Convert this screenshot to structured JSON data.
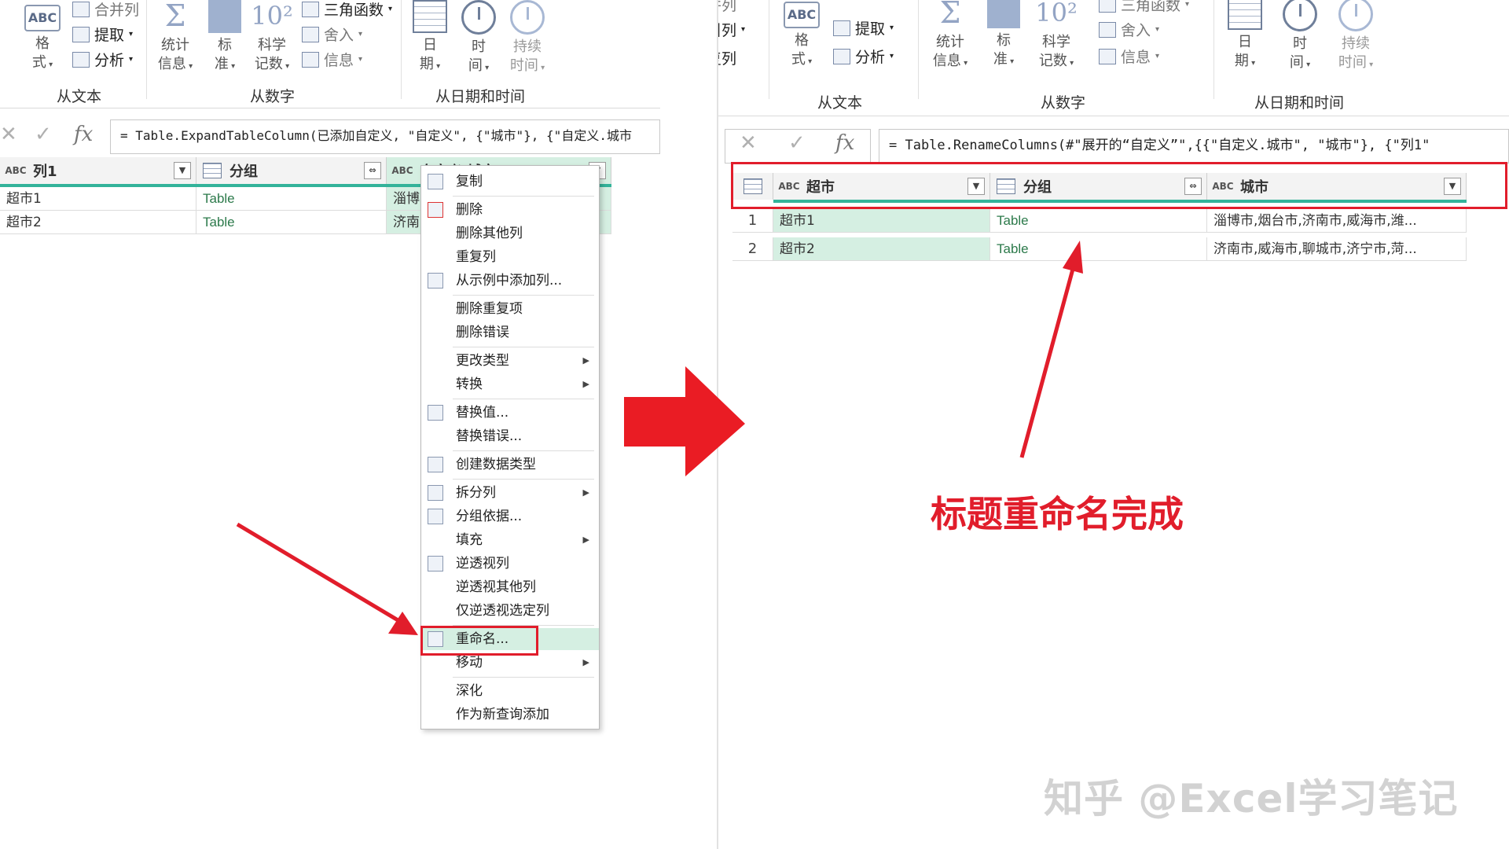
{
  "left": {
    "ribbon": {
      "items": {
        "format_line1": "格",
        "format_line2": "式",
        "merge": "合并列",
        "extract": "提取",
        "parse": "分析",
        "stats_line1": "统计",
        "stats_line2": "信息",
        "standard_line1": "标",
        "standard_line2": "准",
        "sci_line1": "科学",
        "sci_line2": "记数",
        "trig": "三角函数",
        "round": "舍入",
        "info": "信息",
        "date_line1": "日",
        "date_line2": "期",
        "time_line1": "时",
        "time_line2": "间",
        "duration_line1": "持续",
        "duration_line2": "时间"
      },
      "groups": {
        "text": "从文本",
        "number": "从数字",
        "datetime": "从日期和时间"
      }
    },
    "formula": "= Table.ExpandTableColumn(已添加自定义, \"自定义\", {\"城市\"}, {\"自定义.城市",
    "columns": {
      "col1": "列1",
      "col2": "分组",
      "col3": "自定义.城市"
    },
    "rows": [
      {
        "c1": "超市1",
        "c2": "Table",
        "c3": "淄博"
      },
      {
        "c1": "超市2",
        "c2": "Table",
        "c3": "济南"
      }
    ],
    "menu": {
      "copy": "复制",
      "remove": "删除",
      "remove_other": "删除其他列",
      "duplicate": "重复列",
      "add_from_examples": "从示例中添加列...",
      "remove_duplicates": "删除重复项",
      "remove_errors": "删除错误",
      "change_type": "更改类型",
      "transform": "转换",
      "replace_values": "替换值...",
      "replace_errors": "替换错误...",
      "create_data_type": "创建数据类型",
      "split_column": "拆分列",
      "group_by": "分组依据...",
      "fill": "填充",
      "unpivot": "逆透视列",
      "unpivot_other": "逆透视其他列",
      "unpivot_selected": "仅逆透视选定列",
      "rename": "重命名...",
      "move": "移动",
      "drill_down": "深化",
      "add_as_new_query": "作为新查询添加"
    }
  },
  "right": {
    "ribbon": {
      "items": {
        "index": "索引列",
        "dup": "重复列",
        "merge": "合并列",
        "extract": "提取",
        "parse": "分析",
        "format_line1": "格",
        "format_line2": "式",
        "stats_line1": "统计",
        "stats_line2": "信息",
        "standard_line1": "标",
        "standard_line2": "准",
        "sci_line1": "科学",
        "sci_line2": "记数",
        "trig": "三角函数",
        "round": "舍入",
        "info": "信息",
        "date_line1": "日",
        "date_line2": "期",
        "time_line1": "时",
        "time_line2": "间",
        "duration_line1": "持续",
        "duration_line2": "时间"
      },
      "groups": {
        "text": "从文本",
        "number": "从数字",
        "datetime": "从日期和时间"
      }
    },
    "formula": "= Table.RenameColumns(#\"展开的“自定义”\",{{\"自定义.城市\", \"城市\"}, {\"列1\"",
    "columns": {
      "col1": "超市",
      "col2": "分组",
      "col3": "城市"
    },
    "rows": [
      {
        "num": "1",
        "c1": "超市1",
        "c2": "Table",
        "c3": "淄博市,烟台市,济南市,威海市,潍..."
      },
      {
        "num": "2",
        "c1": "超市2",
        "c2": "Table",
        "c3": "济南市,威海市,聊城市,济宁市,菏..."
      }
    ]
  },
  "annotation_text": "标题重命名完成",
  "watermark": "知乎 @Excel学习笔记",
  "colors": {
    "annotation": "#e11d2b",
    "selection": "#d5efe2",
    "column_bar": "#33b39a"
  }
}
